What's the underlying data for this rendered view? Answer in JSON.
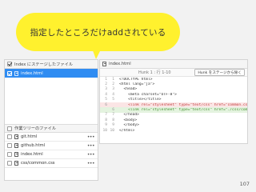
{
  "callout": {
    "text": "指定したところだけaddされている"
  },
  "staging": {
    "header": "Index にステージしたファイル",
    "files": [
      {
        "name": "index.html",
        "checked": true,
        "selected": true
      }
    ]
  },
  "working": {
    "header": "作業ツリーのファイル",
    "files": [
      {
        "name": "git.html",
        "checked": false,
        "more": "•••"
      },
      {
        "name": "github.html",
        "checked": false,
        "more": "•••"
      },
      {
        "name": "index.html",
        "checked": false,
        "more": "•••"
      },
      {
        "name": "css/common.css",
        "checked": false,
        "more": "•••"
      }
    ]
  },
  "diff": {
    "filename": "index.html",
    "hunk_label": "Hunk 1 : 行 1-10",
    "hunk_button": "Hunk をステージから除く",
    "lines": [
      {
        "n1": "1",
        "n2": "1",
        "type": "ctx",
        "text": "<!DOCTYPE html>"
      },
      {
        "n1": "2",
        "n2": "2",
        "type": "ctx",
        "text": "<html lang=\"ja\">"
      },
      {
        "n1": "3",
        "n2": "3",
        "type": "ctx",
        "text": "  <head>"
      },
      {
        "n1": "4",
        "n2": "4",
        "type": "ctx",
        "text": "    <meta charset=\"UTF-8\">"
      },
      {
        "n1": "5",
        "n2": "5",
        "type": "ctx",
        "text": "    <title></title>"
      },
      {
        "n1": "6",
        "n2": "",
        "type": "del",
        "text": "    <link rel=\"stylesheet\" type=\"text/css\" href=\"common.css\">"
      },
      {
        "n1": "",
        "n2": "6",
        "type": "add",
        "text": "    <link rel=\"stylesheet\" type=\"text/css\" href=\"./css/common.css\">"
      },
      {
        "n1": "7",
        "n2": "7",
        "type": "ctx",
        "text": "  </head>"
      },
      {
        "n1": "8",
        "n2": "8",
        "type": "ctx",
        "text": "  <body>"
      },
      {
        "n1": "9",
        "n2": "9",
        "type": "ctx",
        "text": "  </body>"
      },
      {
        "n1": "10",
        "n2": "10",
        "type": "ctx",
        "text": "</html>"
      }
    ]
  },
  "page_number": "107"
}
